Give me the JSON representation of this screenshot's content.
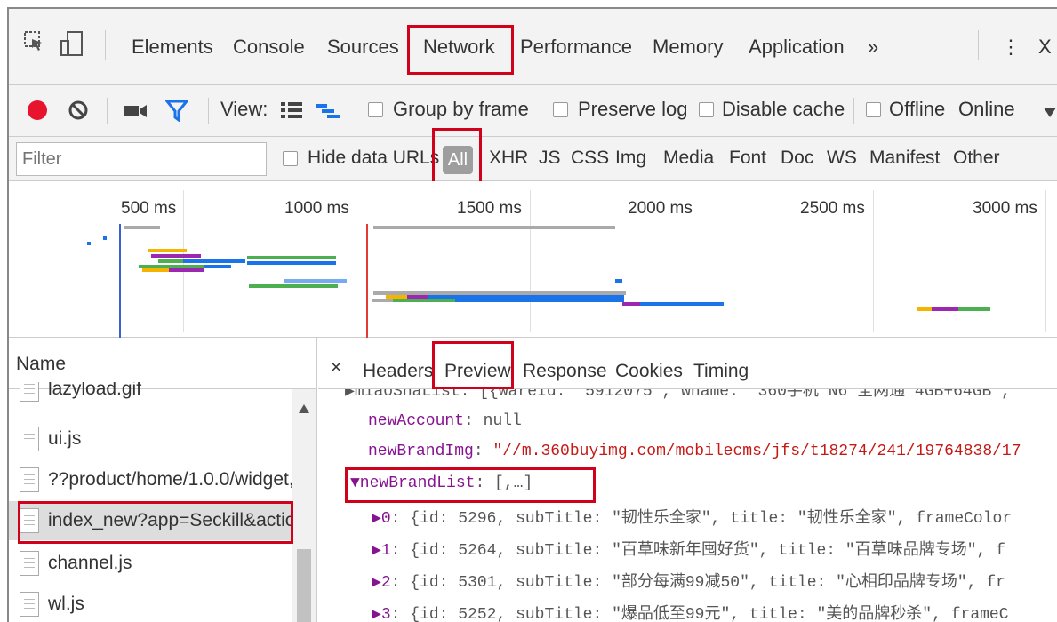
{
  "tabs": [
    "Elements",
    "Console",
    "Sources",
    "Network",
    "Performance",
    "Memory",
    "Application",
    "»"
  ],
  "window": {
    "close": "X",
    "more": "⋮"
  },
  "toolbar": {
    "view_label": "View:",
    "group_by_frame": "Group by frame",
    "preserve_log": "Preserve log",
    "disable_cache": "Disable cache",
    "offline": "Offline",
    "online": "Online"
  },
  "filter": {
    "placeholder": "Filter",
    "hide_data_urls": "Hide data URLs",
    "types": [
      "All",
      "XHR",
      "JS",
      "CSS",
      "Img",
      "Media",
      "Font",
      "Doc",
      "WS",
      "Manifest",
      "Other"
    ]
  },
  "overview": {
    "ticks": [
      "500 ms",
      "1000 ms",
      "1500 ms",
      "2000 ms",
      "2500 ms",
      "3000 ms"
    ]
  },
  "requests": {
    "header": "Name",
    "items": [
      "lazyload.gif",
      "ui.js",
      "??product/home/1.0.0/widget,",
      "index_new?app=Seckill&actic",
      "channel.js",
      "wl.js"
    ]
  },
  "detail": {
    "close": "×",
    "tabs": [
      "Headers",
      "Preview",
      "Response",
      "Cookies",
      "Timing"
    ],
    "cut_line": "▶miaoShaList: [{wareId: \"5912075\", wname: \"360手机 N6 全网通 4GB+64GB\",",
    "lines": [
      {
        "key": "newAccount",
        "sep": ": ",
        "value": "null"
      },
      {
        "key": "newBrandImg",
        "sep": ": ",
        "value": "\"//m.360buyimg.com/mobilecms/jfs/t18274/241/19764838/17"
      }
    ],
    "list_key": "▼newBrandList",
    "list_value": ": [,…]",
    "entries": [
      {
        "idx": "▶0",
        "body": ": {id: 5296, subTitle: \"韧性乐全家\", title: \"韧性乐全家\", frameColor"
      },
      {
        "idx": "▶1",
        "body": ": {id: 5264, subTitle: \"百草味新年囤好货\", title: \"百草味品牌专场\", f"
      },
      {
        "idx": "▶2",
        "body": ": {id: 5301, subTitle: \"部分每满99减50\", title: \"心相印品牌专场\", fr"
      },
      {
        "idx": "▶3",
        "body": ": {id: 5252, subTitle: \"爆品低至99元\", title: \"美的品牌秒杀\", frameC"
      }
    ]
  },
  "colors": {
    "accent": "#1a73e8",
    "highlight": "#d0021b",
    "record": "#e8132d",
    "filter_icon": "#1a73e8"
  }
}
